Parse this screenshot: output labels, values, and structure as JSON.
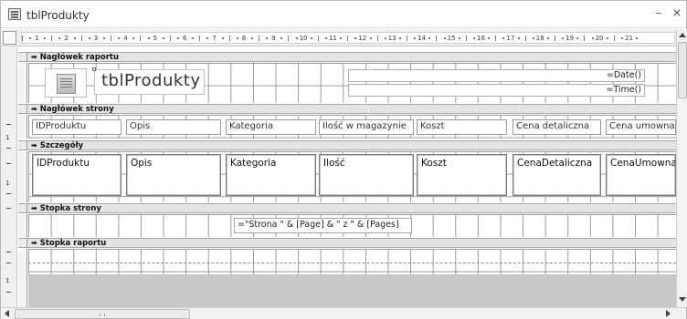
{
  "window": {
    "title": "tblProdukty",
    "minimize_icon": "minimize-icon",
    "close_icon": "close-icon",
    "minimize": "–",
    "close": "×"
  },
  "ruler": {
    "numbers": [
      "1",
      "2",
      "3",
      "4",
      "5",
      "6",
      "7",
      "8",
      "9",
      "10",
      "11",
      "12",
      "13",
      "14",
      "15",
      "16",
      "17",
      "18",
      "19",
      "20",
      "21"
    ]
  },
  "vruler": {
    "labels": [
      "1",
      "1",
      "1"
    ]
  },
  "sections": {
    "report_header": {
      "label": "Nagłówek raportu"
    },
    "page_header": {
      "label": "Nagłówek strony"
    },
    "details": {
      "label": "Szczegóły"
    },
    "page_footer": {
      "label": "Stopka strony"
    },
    "report_footer": {
      "label": "Stopka raportu"
    }
  },
  "report_header": {
    "title": "tblProdukty",
    "date": "=Date()",
    "time": "=Time()"
  },
  "page_header": {
    "labels": [
      "IDProduktu",
      "Opis",
      "Kategoria",
      "Ilość w magazynie",
      "Koszt",
      "Cena detaliczna",
      "Cena umowna"
    ]
  },
  "details": {
    "fields": [
      "IDProduktu",
      "Opis",
      "Kategoria",
      "Ilość",
      "Koszt",
      "CenaDetaliczna",
      "CenaUmowna"
    ]
  },
  "page_footer": {
    "expression": "=\"Strona \" & [Page] & \" z \" & [Pages]"
  },
  "colors": {
    "section_bar": "#e4e4e4",
    "grid": "#9a9a9a",
    "empty_area": "#c9c9c9"
  }
}
